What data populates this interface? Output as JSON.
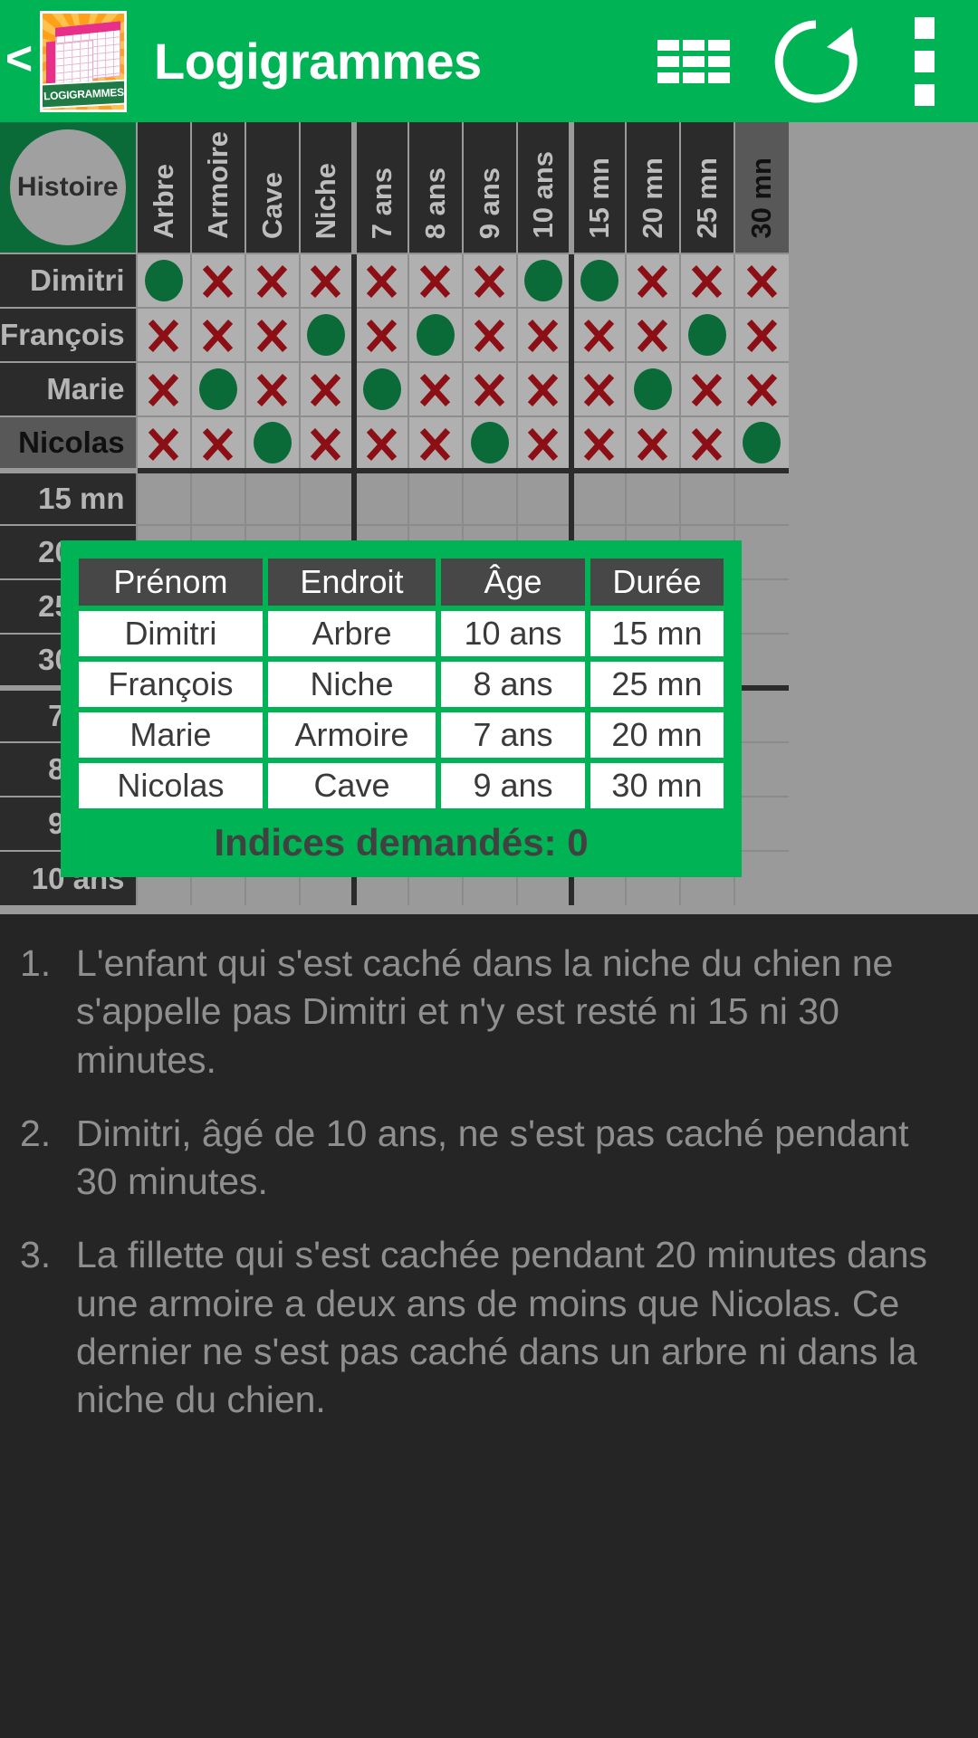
{
  "appbar": {
    "back_label": "<",
    "title": "Logigrammes",
    "app_icon_label": "LOGIGRAMMES",
    "grid_icon": "grid-view-icon",
    "refresh_icon": "refresh-icon",
    "menu_icon": "overflow-menu-icon"
  },
  "grid": {
    "corner_label": "Histoire",
    "columns": [
      {
        "label": "Arbre",
        "group": "endroit",
        "highlight": false
      },
      {
        "label": "Armoire",
        "group": "endroit",
        "highlight": false
      },
      {
        "label": "Cave",
        "group": "endroit",
        "highlight": false
      },
      {
        "label": "Niche",
        "group": "endroit",
        "highlight": false
      },
      {
        "label": "7 ans",
        "group": "age",
        "highlight": false
      },
      {
        "label": "8 ans",
        "group": "age",
        "highlight": false
      },
      {
        "label": "9 ans",
        "group": "age",
        "highlight": false
      },
      {
        "label": "10 ans",
        "group": "age",
        "highlight": false
      },
      {
        "label": "15 mn",
        "group": "duree",
        "highlight": false
      },
      {
        "label": "20 mn",
        "group": "duree",
        "highlight": false
      },
      {
        "label": "25 mn",
        "group": "duree",
        "highlight": false
      },
      {
        "label": "30 mn",
        "group": "duree",
        "highlight": true
      }
    ],
    "rows": [
      {
        "label": "Dimitri",
        "highlight": false,
        "group": "prenom",
        "marks": [
          "o",
          "x",
          "x",
          "x",
          "x",
          "x",
          "x",
          "o",
          "o",
          "x",
          "x",
          "x"
        ]
      },
      {
        "label": "François",
        "highlight": false,
        "group": "prenom",
        "marks": [
          "x",
          "x",
          "x",
          "o",
          "x",
          "o",
          "x",
          "x",
          "x",
          "x",
          "o",
          "x"
        ]
      },
      {
        "label": "Marie",
        "highlight": false,
        "group": "prenom",
        "marks": [
          "x",
          "o",
          "x",
          "x",
          "o",
          "x",
          "x",
          "x",
          "x",
          "o",
          "x",
          "x"
        ]
      },
      {
        "label": "Nicolas",
        "highlight": true,
        "group": "prenom",
        "marks": [
          "x",
          "x",
          "o",
          "x",
          "x",
          "x",
          "o",
          "x",
          "x",
          "x",
          "x",
          "o"
        ]
      },
      {
        "label": "15 mn",
        "highlight": false,
        "group": "duree",
        "marks": [
          "",
          "",
          "",
          "",
          "",
          "",
          "",
          "",
          "",
          "",
          "",
          ""
        ]
      },
      {
        "label": "20 mn",
        "highlight": false,
        "group": "duree",
        "marks": [
          "",
          "",
          "",
          "",
          "",
          "",
          "",
          "",
          "",
          "",
          "",
          ""
        ]
      },
      {
        "label": "25 mn",
        "highlight": false,
        "group": "duree",
        "marks": [
          "",
          "",
          "",
          "",
          "",
          "",
          "",
          "",
          "",
          "",
          "",
          ""
        ]
      },
      {
        "label": "30 mn",
        "highlight": false,
        "group": "duree",
        "marks": [
          "",
          "",
          "",
          "",
          "",
          "",
          "",
          "",
          "",
          "",
          "",
          ""
        ]
      },
      {
        "label": "7 ans",
        "highlight": false,
        "group": "age",
        "marks": [
          "",
          "",
          "",
          "",
          "",
          "",
          "",
          "",
          "",
          "",
          "",
          ""
        ]
      },
      {
        "label": "8 ans",
        "highlight": false,
        "group": "age",
        "marks": [
          "",
          "",
          "",
          "",
          "",
          "",
          "",
          "",
          "",
          "",
          "",
          ""
        ]
      },
      {
        "label": "9 ans",
        "highlight": false,
        "group": "age",
        "marks": [
          "",
          "",
          "",
          "",
          "",
          "",
          "",
          "",
          "",
          "",
          "",
          ""
        ]
      },
      {
        "label": "10 ans",
        "highlight": false,
        "group": "age",
        "marks": [
          "",
          "",
          "",
          "",
          "",
          "",
          "",
          "",
          "",
          "",
          "",
          ""
        ]
      }
    ]
  },
  "solution": {
    "headers": [
      "Prénom",
      "Endroit",
      "Âge",
      "Durée"
    ],
    "rows": [
      [
        "Dimitri",
        "Arbre",
        "10 ans",
        "15 mn"
      ],
      [
        "François",
        "Niche",
        "8 ans",
        "25 mn"
      ],
      [
        "Marie",
        "Armoire",
        "7 ans",
        "20 mn"
      ],
      [
        "Nicolas",
        "Cave",
        "9 ans",
        "30 mn"
      ]
    ],
    "footer": "Indices demandés: 0"
  },
  "clues": [
    {
      "num": "1.",
      "text": "L'enfant qui s'est caché dans la niche du chien ne s'appelle pas Dimitri et n'y est resté ni 15 ni 30 minutes."
    },
    {
      "num": "2.",
      "text": "Dimitri, âgé de 10 ans, ne s'est pas caché pendant 30 minutes."
    },
    {
      "num": "3.",
      "text": "La fillette qui s'est cachée pendant 20 minutes dans une armoire a deux ans de moins que Nicolas. Ce dernier ne s'est pas caché dans un arbre ni dans la niche du chien."
    }
  ],
  "colors": {
    "accent_green": "#00b355",
    "dark_green": "#0b6b38",
    "mark_green": "#0a6b38",
    "mark_red": "#8b0f14",
    "panel_dark": "#2b2b2b",
    "cell_gray": "#b0b0b0"
  }
}
